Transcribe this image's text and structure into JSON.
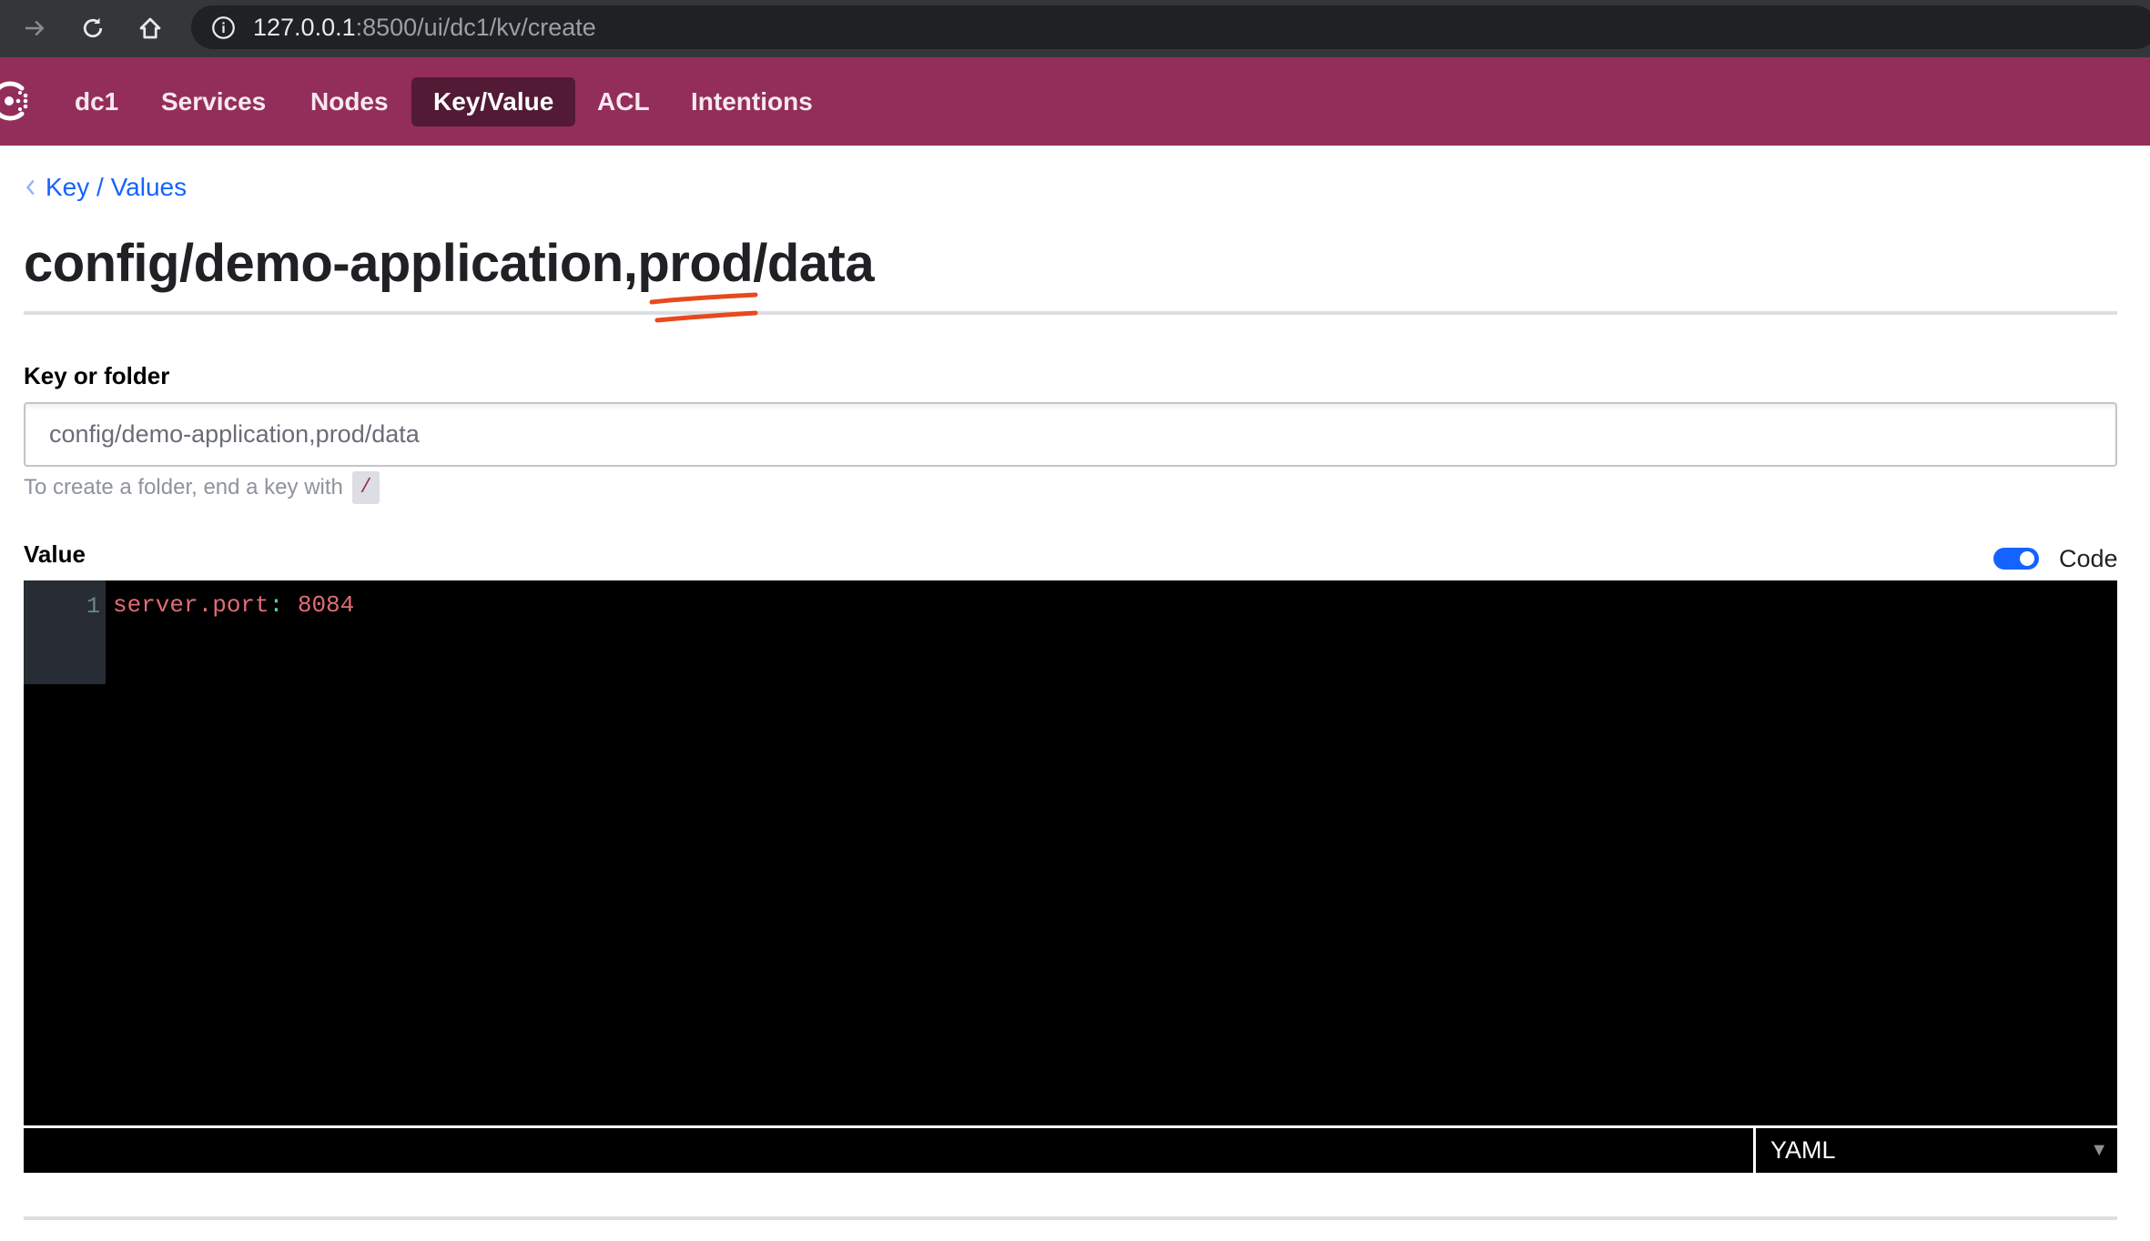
{
  "browser": {
    "url_host": "127.0.0.1",
    "url_path": ":8500/ui/dc1/kv/create",
    "icons": [
      "forward-icon",
      "reload-icon",
      "home-icon",
      "site-info-icon"
    ]
  },
  "nav": {
    "logo": "consul-logo",
    "datacenter": "dc1",
    "items": [
      {
        "label": "Services",
        "active": false
      },
      {
        "label": "Nodes",
        "active": false
      },
      {
        "label": "Key/Value",
        "active": true
      },
      {
        "label": "ACL",
        "active": false
      },
      {
        "label": "Intentions",
        "active": false
      }
    ],
    "brand_color": "#932e5a",
    "active_color": "#521a34"
  },
  "breadcrumb": {
    "label": "Key / Values"
  },
  "page": {
    "title": "config/demo-application,prod/data",
    "annotation": "red underline under 'prod'"
  },
  "form": {
    "key_label": "Key or folder",
    "key_value": "config/demo-application,prod/data",
    "help_text": "To create a folder, end a key with",
    "help_code": "/",
    "value_label": "Value",
    "code_toggle": {
      "label": "Code",
      "on": true
    },
    "editor": {
      "lines": [
        {
          "number": "1",
          "key": "server.port",
          "colon": ":",
          "value": " 8084"
        }
      ],
      "mode": "YAML",
      "mode_arrow": "▼"
    }
  },
  "colors": {
    "link": "#1563ff",
    "toggle": "#1563ff",
    "annotation": "#e8491d"
  }
}
